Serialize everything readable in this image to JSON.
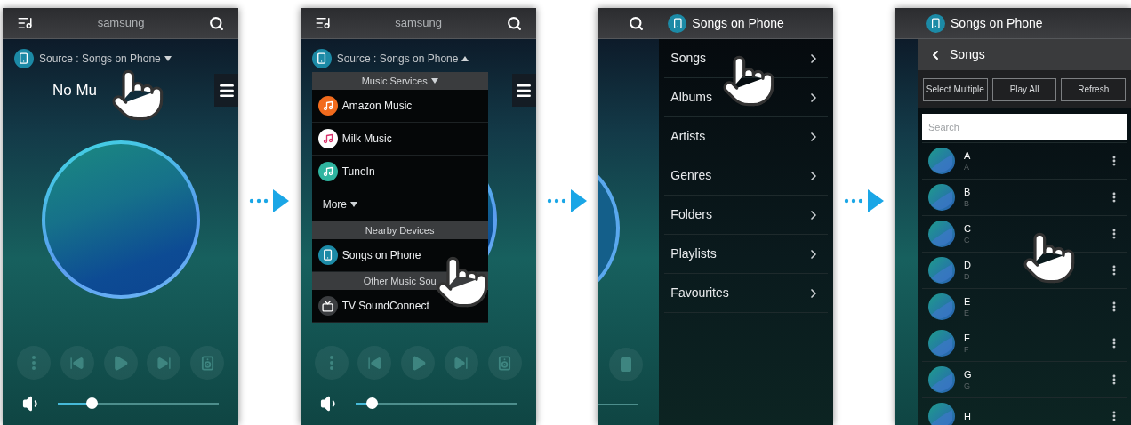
{
  "screens": [
    {
      "kind": "player",
      "header": {
        "title": "samsung"
      },
      "source": {
        "label": "Source : Songs on Phone",
        "expanded": false
      },
      "now_playing": "No Mu",
      "volume": {
        "level": 0.21
      }
    },
    {
      "kind": "player",
      "header": {
        "title": "samsung"
      },
      "source": {
        "label": "Source : Songs on Phone",
        "expanded": true
      },
      "volume": {
        "level": 0.1
      },
      "source_menu": [
        {
          "kind": "section",
          "label": "Music Services",
          "expanded": false
        },
        {
          "kind": "service",
          "label": "Amazon Music",
          "color": "#f26b1d"
        },
        {
          "kind": "service",
          "label": "Milk Music",
          "color": "#ffffff"
        },
        {
          "kind": "service",
          "label": "TuneIn",
          "color": "#2fb5a0"
        },
        {
          "kind": "more",
          "label": "More",
          "expanded": false
        },
        {
          "kind": "section",
          "label": "Nearby Devices"
        },
        {
          "kind": "phone",
          "label": "Songs on Phone"
        },
        {
          "kind": "section",
          "label": "Other Music Sou"
        },
        {
          "kind": "tv",
          "label": "TV SoundConnect"
        }
      ]
    },
    {
      "kind": "library",
      "panel_title": "Songs on Phone",
      "items": [
        {
          "label": "Songs"
        },
        {
          "label": "Albums"
        },
        {
          "label": "Artists"
        },
        {
          "label": "Genres"
        },
        {
          "label": "Folders"
        },
        {
          "label": "Playlists"
        },
        {
          "label": "Favourites"
        }
      ]
    },
    {
      "kind": "songs",
      "panel_title": "Songs on Phone",
      "back_label": "Songs",
      "actions": [
        "Select Multiple",
        "Play All",
        "Refresh"
      ],
      "search": {
        "placeholder": "Search"
      },
      "songs": [
        {
          "title": "A",
          "subtitle": "A"
        },
        {
          "title": "B",
          "subtitle": "B"
        },
        {
          "title": "C",
          "subtitle": "C"
        },
        {
          "title": "D",
          "subtitle": "D"
        },
        {
          "title": "E",
          "subtitle": "E"
        },
        {
          "title": "F",
          "subtitle": "F"
        },
        {
          "title": "G",
          "subtitle": "G"
        },
        {
          "title": "H"
        }
      ]
    }
  ]
}
